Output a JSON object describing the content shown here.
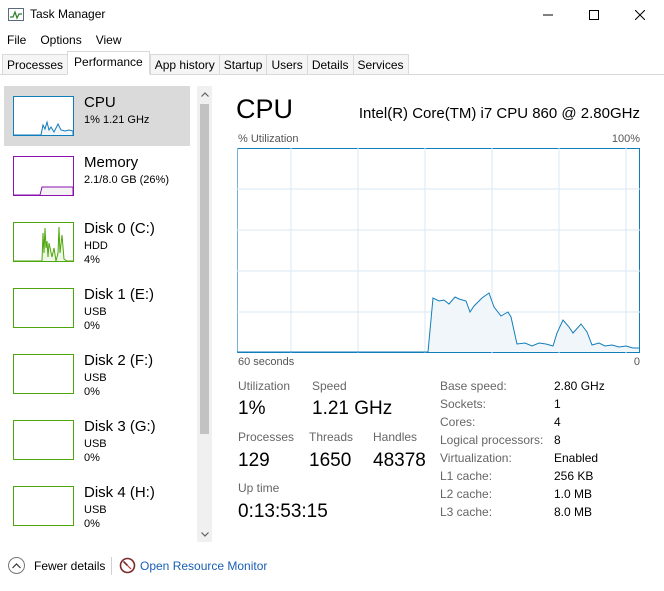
{
  "window": {
    "title": "Task Manager",
    "icon": "task-manager-icon",
    "controls": [
      "minimize-icon",
      "maximize-icon",
      "close-icon"
    ]
  },
  "menu": [
    "File",
    "Options",
    "View"
  ],
  "tabs": [
    "Processes",
    "Performance",
    "App history",
    "Startup",
    "Users",
    "Details",
    "Services"
  ],
  "active_tab": "Performance",
  "sidebar": {
    "items": [
      {
        "name": "CPU",
        "line1": "1% 1.21 GHz",
        "line2": "",
        "color": "#117dbb",
        "selected": true
      },
      {
        "name": "Memory",
        "line1": "2.1/8.0 GB (26%)",
        "line2": "",
        "color": "#8b12ae",
        "selected": false
      },
      {
        "name": "Disk 0 (C:)",
        "line1": "HDD",
        "line2": "4%",
        "color": "#4da60c",
        "selected": false
      },
      {
        "name": "Disk 1 (E:)",
        "line1": "USB",
        "line2": "0%",
        "color": "#4da60c",
        "selected": false
      },
      {
        "name": "Disk 2 (F:)",
        "line1": "USB",
        "line2": "0%",
        "color": "#4da60c",
        "selected": false
      },
      {
        "name": "Disk 3 (G:)",
        "line1": "USB",
        "line2": "0%",
        "color": "#4da60c",
        "selected": false
      },
      {
        "name": "Disk 4 (H:)",
        "line1": "USB",
        "line2": "0%",
        "color": "#4da60c",
        "selected": false
      }
    ]
  },
  "main": {
    "title": "CPU",
    "model": "Intel(R) Core(TM) i7 CPU 860 @ 2.80GHz",
    "graph": {
      "top_left": "% Utilization",
      "top_right": "100%",
      "bottom_left": "60 seconds",
      "bottom_right": "0",
      "line_color": "#117dbb",
      "fill_color": "#f1f6fa",
      "grid_color": "#d9eaf4"
    },
    "stats": {
      "utilization_label": "Utilization",
      "utilization_value": "1%",
      "speed_label": "Speed",
      "speed_value": "1.21 GHz",
      "processes_label": "Processes",
      "processes_value": "129",
      "threads_label": "Threads",
      "threads_value": "1650",
      "handles_label": "Handles",
      "handles_value": "48378",
      "uptime_label": "Up time",
      "uptime_value": "0:13:53:15"
    },
    "specs": [
      {
        "label": "Base speed:",
        "value": "2.80 GHz"
      },
      {
        "label": "Sockets:",
        "value": "1"
      },
      {
        "label": "Cores:",
        "value": "4"
      },
      {
        "label": "Logical processors:",
        "value": "8"
      },
      {
        "label": "Virtualization:",
        "value": "Enabled"
      },
      {
        "label": "L1 cache:",
        "value": "256 KB"
      },
      {
        "label": "L2 cache:",
        "value": "1.0 MB"
      },
      {
        "label": "L3 cache:",
        "value": "8.0 MB"
      }
    ]
  },
  "footer": {
    "fewer_details": "Fewer details",
    "open_monitor": "Open Resource Monitor"
  }
}
